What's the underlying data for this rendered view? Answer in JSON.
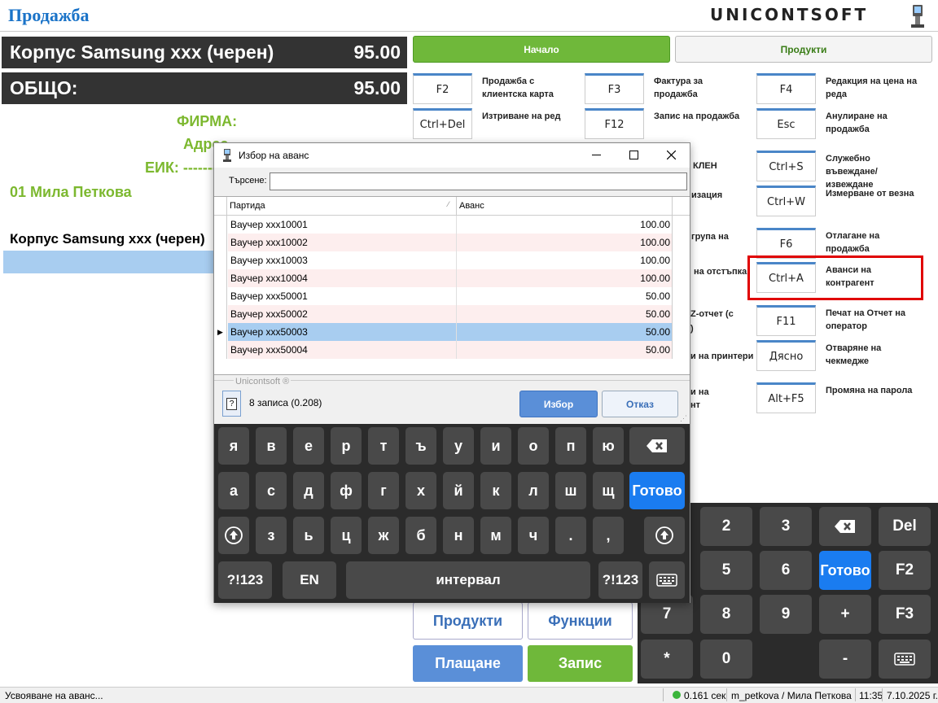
{
  "app_title": "Продажба",
  "brand": "Unicontsoft",
  "product_line": {
    "name": "Корпус Samsung xxx (черен)",
    "price": "95.00"
  },
  "total": {
    "label": "ОБЩО:",
    "value": "95.00"
  },
  "company": {
    "firm": "ФИРМА:",
    "address": "Адрес",
    "eik": "ЕИК: -------"
  },
  "operator_line": "01 Мила Петкова",
  "receipt_item": "Корпус Samsung xxx (черен)",
  "tabs": {
    "start": "Начало",
    "products": "Продукти"
  },
  "fkeys": [
    {
      "key": "F2",
      "label": "Продажба с клиентска карта"
    },
    {
      "key": "F3",
      "label": "Фактура за продажба"
    },
    {
      "key": "F4",
      "label": "Редакция на цена на реда"
    },
    {
      "key": "Ctrl+Del",
      "label": "Изтриване на ред"
    },
    {
      "key": "F12",
      "label": "Запис на продажба"
    },
    {
      "key": "Esc",
      "label": "Анулиране на продажба"
    },
    {
      "key": "Ctrl+S",
      "label": "Служебно въвеждане/извеждане"
    },
    {
      "key": "Ctrl+W",
      "label": "Измерване от везна"
    },
    {
      "key": "F6",
      "label": "Отлагане на продажба"
    },
    {
      "key": "Ctrl+A",
      "label": "Аванси на контрагент"
    },
    {
      "key": "F11",
      "label": "Печат на Отчет на оператор"
    },
    {
      "key": "Дясно",
      "label": "Отваряне на чекмедже"
    },
    {
      "key": "Alt+F5",
      "label": "Промяна на парола"
    }
  ],
  "mid_fragments": [
    "КЛЕН",
    "изация",
    "група на",
    "на отстъпка",
    "Z-отчет (с",
    ")",
    "и на принтери",
    "и на",
    "нт"
  ],
  "bottom_buttons": {
    "products": "Продукти",
    "functions": "Функции",
    "payment": "Плащане",
    "save": "Запис"
  },
  "numpad": {
    "row1": [
      "2",
      "3"
    ],
    "del": "Del",
    "row2": [
      "5",
      "6"
    ],
    "done": "Готово",
    "f2": "F2",
    "row3": [
      "7",
      "8",
      "9",
      "+"
    ],
    "f3": "F3",
    "row4": [
      "*",
      "0",
      "-"
    ]
  },
  "status_bar": {
    "message": "Усвояване на аванс...",
    "timing": "0.161 сек",
    "user": "m_petkova / Мила Петкова",
    "time": "11:35",
    "date": "7.10.2025 г."
  },
  "dialog": {
    "title": "Избор на аванс",
    "search_label": "Търсене:",
    "search_value": "",
    "columns": [
      "Партида",
      "Аванс"
    ],
    "rows": [
      {
        "name": "Ваучер xxx10001",
        "amount": "100.00"
      },
      {
        "name": "Ваучер xxx10002",
        "amount": "100.00"
      },
      {
        "name": "Ваучер xxx10003",
        "amount": "100.00"
      },
      {
        "name": "Ваучер xxx10004",
        "amount": "100.00"
      },
      {
        "name": "Ваучер xxx50001",
        "amount": "50.00"
      },
      {
        "name": "Ваучер xxx50002",
        "amount": "50.00"
      },
      {
        "name": "Ваучер xxx50003",
        "amount": "50.00"
      },
      {
        "name": "Ваучер xxx50004",
        "amount": "50.00"
      }
    ],
    "selected_row": 6,
    "group_label": "Unicontsoft ®",
    "record_count": "8 записа (0.208)",
    "ok": "Избор",
    "cancel": "Отказ"
  },
  "keyboard": {
    "row1": [
      "я",
      "в",
      "е",
      "р",
      "т",
      "ъ",
      "у",
      "и",
      "о",
      "п",
      "ю"
    ],
    "row2": [
      "а",
      "с",
      "д",
      "ф",
      "г",
      "х",
      "й",
      "к",
      "л",
      "ш",
      "щ"
    ],
    "done": "Готово",
    "row3": [
      "з",
      "ь",
      "ц",
      "ж",
      "б",
      "н",
      "м",
      "ч",
      ".",
      ","
    ],
    "sym": "?!123",
    "lang": "EN",
    "space": "интервал"
  },
  "colors": {
    "accent_blue": "#1a73c8",
    "green": "#7cb82f",
    "highlight": "#e00000",
    "selected_row": "#a8cdf0",
    "done_blue": "#1a7cf0"
  }
}
